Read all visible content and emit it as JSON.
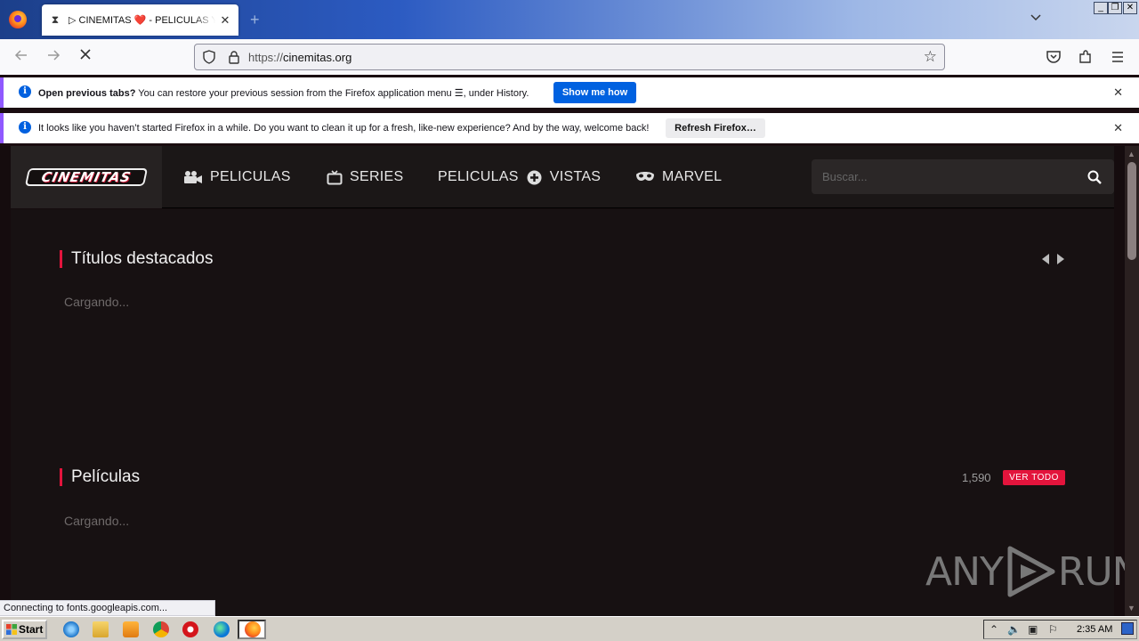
{
  "browser": {
    "tab_title": "▷ CINEMITAS ❤️ - PELICULAS Y SERIES",
    "url_scheme": "https://",
    "url_host": "cinemitas.org",
    "status_text": "Connecting to fonts.googleapis.com..."
  },
  "notifications": [
    {
      "bold": "Open previous tabs?",
      "text": " You can restore your previous session from the Firefox application menu ",
      "text_after": ", under History.",
      "button": "Show me how"
    },
    {
      "text": "It looks like you haven’t started Firefox in a while. Do you want to clean it up for a fresh, like-new experience? And by the way, welcome back!",
      "button": "Refresh Firefox…"
    }
  ],
  "site": {
    "logo_text": "CINEMITAS",
    "menu": [
      {
        "label": "PELICULAS",
        "icon": "camera-icon"
      },
      {
        "label": "SERIES",
        "icon": "tv-icon"
      },
      {
        "label_before": "PELICULAS",
        "label_after": "VISTAS",
        "icon": "plus-circle-icon"
      },
      {
        "label": "MARVEL",
        "icon": "mask-icon"
      }
    ],
    "search_placeholder": "Buscar...",
    "sections": [
      {
        "title": "Títulos destacados",
        "loading": "Cargando..."
      },
      {
        "title": "Películas",
        "loading": "Cargando...",
        "count": "1,590",
        "view_all": "VER TODO"
      }
    ],
    "accent_color": "#e3143c"
  },
  "watermark": {
    "left": "ANY",
    "right": "RUN"
  },
  "taskbar": {
    "start_label": "Start",
    "clock": "2:35 AM"
  }
}
